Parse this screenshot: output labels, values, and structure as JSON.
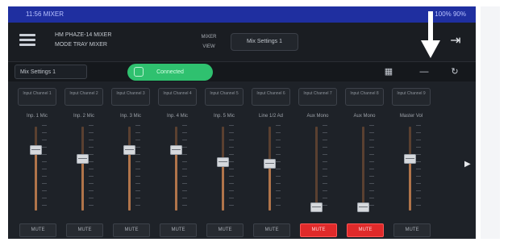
{
  "status_bar": {
    "left_text": "11:56 MIXER",
    "right_text": "100% 90%"
  },
  "header": {
    "device_line1": "HM PHAZE-14 MIXER",
    "device_line2": "MODE TRAY MIXER",
    "context_label": "MIXER VIEW",
    "context_value": "Mix Settings 1"
  },
  "toolbar": {
    "view_select": "Mix Settings 1",
    "connect_label": "Connected"
  },
  "channels": [
    {
      "source": "Input Channel 1",
      "name": "Inp. 1 Mic",
      "level": 0.72,
      "mute": "MUTE",
      "muted": false
    },
    {
      "source": "Input Channel 2",
      "name": "Inp. 2 Mic",
      "level": 0.62,
      "mute": "MUTE",
      "muted": false
    },
    {
      "source": "Input Channel 3",
      "name": "Inp. 3 Mic",
      "level": 0.72,
      "mute": "MUTE",
      "muted": false
    },
    {
      "source": "Input Channel 4",
      "name": "Inp. 4 Mic",
      "level": 0.72,
      "mute": "MUTE",
      "muted": false
    },
    {
      "source": "Input Channel 5",
      "name": "Inp. 5 Mic",
      "level": 0.58,
      "mute": "MUTE",
      "muted": false
    },
    {
      "source": "Input Channel 6",
      "name": "Line 1/2 Ad",
      "level": 0.56,
      "mute": "MUTE",
      "muted": false
    },
    {
      "source": "Input Channel 7",
      "name": "Aux Mono",
      "level": 0.04,
      "mute": "MUTE",
      "muted": true
    },
    {
      "source": "Input Channel 8",
      "name": "Aux Mono",
      "level": 0.04,
      "mute": "MUTE",
      "muted": true
    },
    {
      "source": "Input Channel 9",
      "name": "Master Vol",
      "level": 0.62,
      "mute": "MUTE",
      "muted": false
    }
  ],
  "colors": {
    "accent_green": "#2fc16f",
    "mute_red": "#e02a2a",
    "status_blue": "#1f2fa0"
  },
  "icons": [
    "menu-icon",
    "exit-icon",
    "save-icon",
    "minus-icon",
    "refresh-icon",
    "arrow-down-icon",
    "chevron-right-icon"
  ]
}
